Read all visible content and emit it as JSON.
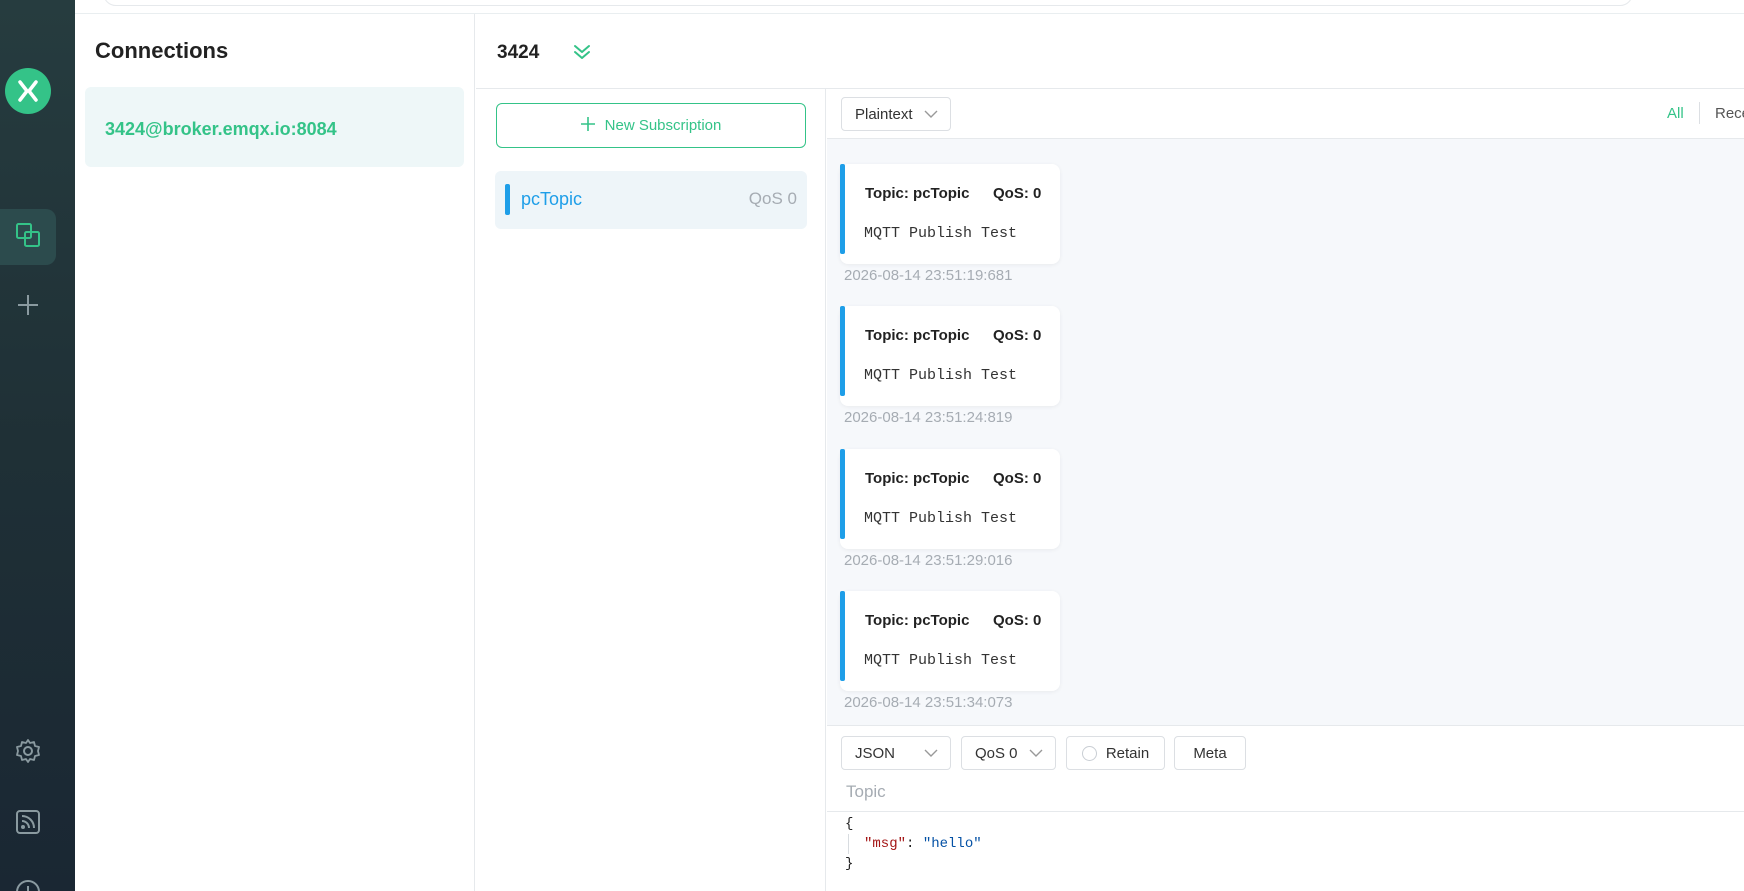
{
  "sidebar": {
    "logo_icon": "mqttx-logo-icon",
    "items": [
      {
        "icon": "connections-icon",
        "active": true
      },
      {
        "icon": "plus-icon",
        "active": false
      },
      {
        "icon": "gear-icon",
        "active": false
      },
      {
        "icon": "rss-icon",
        "active": false
      },
      {
        "icon": "info-icon",
        "active": false
      }
    ]
  },
  "connections": {
    "title": "Connections",
    "items": [
      {
        "label": "3424@broker.emqx.io:8084"
      }
    ]
  },
  "header": {
    "connection_name": "3424"
  },
  "subscriptions": {
    "new_button_label": "New Subscription",
    "items": [
      {
        "topic": "pcTopic",
        "qos": "QoS 0",
        "color": "#1e9ee8"
      }
    ]
  },
  "messages_toolbar": {
    "format": "Plaintext",
    "filter_all": "All",
    "filter_received": "Rece"
  },
  "messages": [
    {
      "topic": "Topic: pcTopic",
      "qos": "QoS: 0",
      "payload": "MQTT Publish Test",
      "time": "2026-08-14 23:51:19:681"
    },
    {
      "topic": "Topic: pcTopic",
      "qos": "QoS: 0",
      "payload": "MQTT Publish Test",
      "time": "2026-08-14 23:51:24:819"
    },
    {
      "topic": "Topic: pcTopic",
      "qos": "QoS: 0",
      "payload": "MQTT Publish Test",
      "time": "2026-08-14 23:51:29:016"
    },
    {
      "topic": "Topic: pcTopic",
      "qos": "QoS: 0",
      "payload": "MQTT Publish Test",
      "time": "2026-08-14 23:51:34:073"
    }
  ],
  "publish": {
    "format": "JSON",
    "qos": "QoS 0",
    "retain_label": "Retain",
    "meta_label": "Meta",
    "topic_placeholder": "Topic",
    "payload": {
      "open": "{",
      "key": "\"msg\"",
      "colon": ": ",
      "value": "\"hello\"",
      "close": "}"
    }
  },
  "colors": {
    "accent": "#34c388",
    "topic_blue": "#1e9ee8",
    "rail_dark": "#1f3036"
  }
}
